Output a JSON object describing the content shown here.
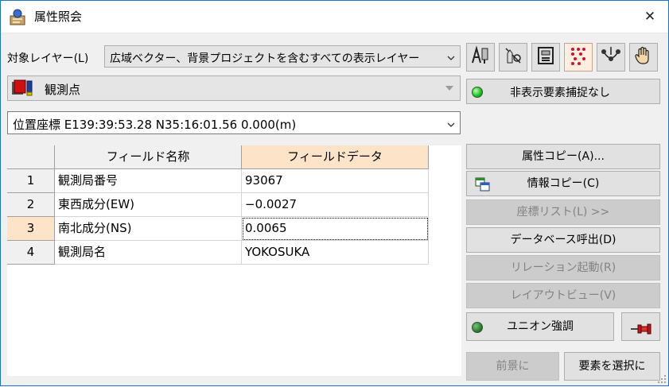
{
  "window": {
    "title": "属性照会",
    "close_symbol": "✕"
  },
  "layer": {
    "label": "対象レイヤー(L)",
    "selected": "広域ベクター、背景プロジェクトを含むすべての表示レイヤー"
  },
  "feature": {
    "selected": "観測点"
  },
  "coords": {
    "selected": "位置座標 E139:39:53.28 N35:16:01.56 0.000(m)"
  },
  "toolbar": {
    "icons": [
      "attribute-pick-icon",
      "pencil-split-icon",
      "frame-icon",
      "dot-grid-icon",
      "vertex-link-icon",
      "hand-icon"
    ],
    "active_index": 3
  },
  "status": {
    "text": "非表示要素捕捉なし",
    "color": "#18c018"
  },
  "table": {
    "headers": [
      "フィールド名称",
      "フィールドデータ"
    ],
    "rows": [
      {
        "no": "1",
        "name": "観測局番号",
        "value": "93067"
      },
      {
        "no": "2",
        "name": "東西成分(EW)",
        "value": "−0.0027"
      },
      {
        "no": "3",
        "name": "南北成分(NS)",
        "value": "0.0065"
      },
      {
        "no": "4",
        "name": "観測局名",
        "value": "YOKOSUKA"
      }
    ],
    "selected_row": 3,
    "selection_color": "#fde3c8"
  },
  "actions": {
    "attr_copy": "属性コピー(A)...",
    "info_copy": "情報コピー(C)",
    "coord_list": "座標リスト(L) >>",
    "db_call": "データベース呼出(D)",
    "relation": "リレーション起動(R)",
    "layout_view": "レイアウトビュー(V)",
    "union_highlight": "ユニオン強調",
    "bring_front": "前景に",
    "select_feature": "要素を選択に"
  }
}
